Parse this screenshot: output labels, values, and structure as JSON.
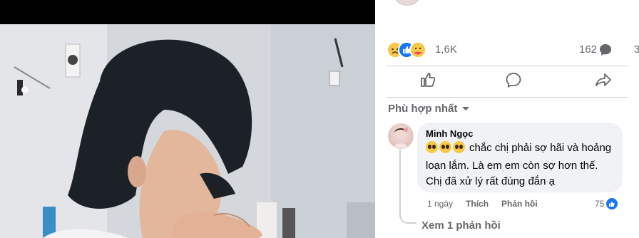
{
  "post": {
    "reaction_count": "1,6K",
    "comment_count": "162",
    "share_count": "3"
  },
  "comments": {
    "sort_label": "Phù hợp nhất",
    "items": [
      {
        "author": "Minh Ngọc",
        "text": "chắc chị phải sợ hãi và hoảng loạn lắm. Là em em còn sợ hơn thế. Chị đã xử lý rất đúng đắn ạ",
        "time": "1 ngày",
        "like_label": "Thích",
        "reply_label": "Phản hồi",
        "like_count": "75"
      }
    ],
    "view_replies": "Xem 1 phản hồi"
  },
  "icons": {
    "reaction_sad": "sad-reaction-icon",
    "reaction_like": "like-reaction-icon",
    "reaction_care": "care-reaction-icon",
    "comment": "comment-bubble-icon",
    "share": "share-icon",
    "action_like": "thumbs-up-icon",
    "action_comment": "comment-icon",
    "action_share": "share-arrow-icon",
    "chevron": "chevron-down-icon"
  },
  "colors": {
    "accent": "#1877f2",
    "muted_text": "#65676b",
    "bubble": "#f0f2f5"
  }
}
